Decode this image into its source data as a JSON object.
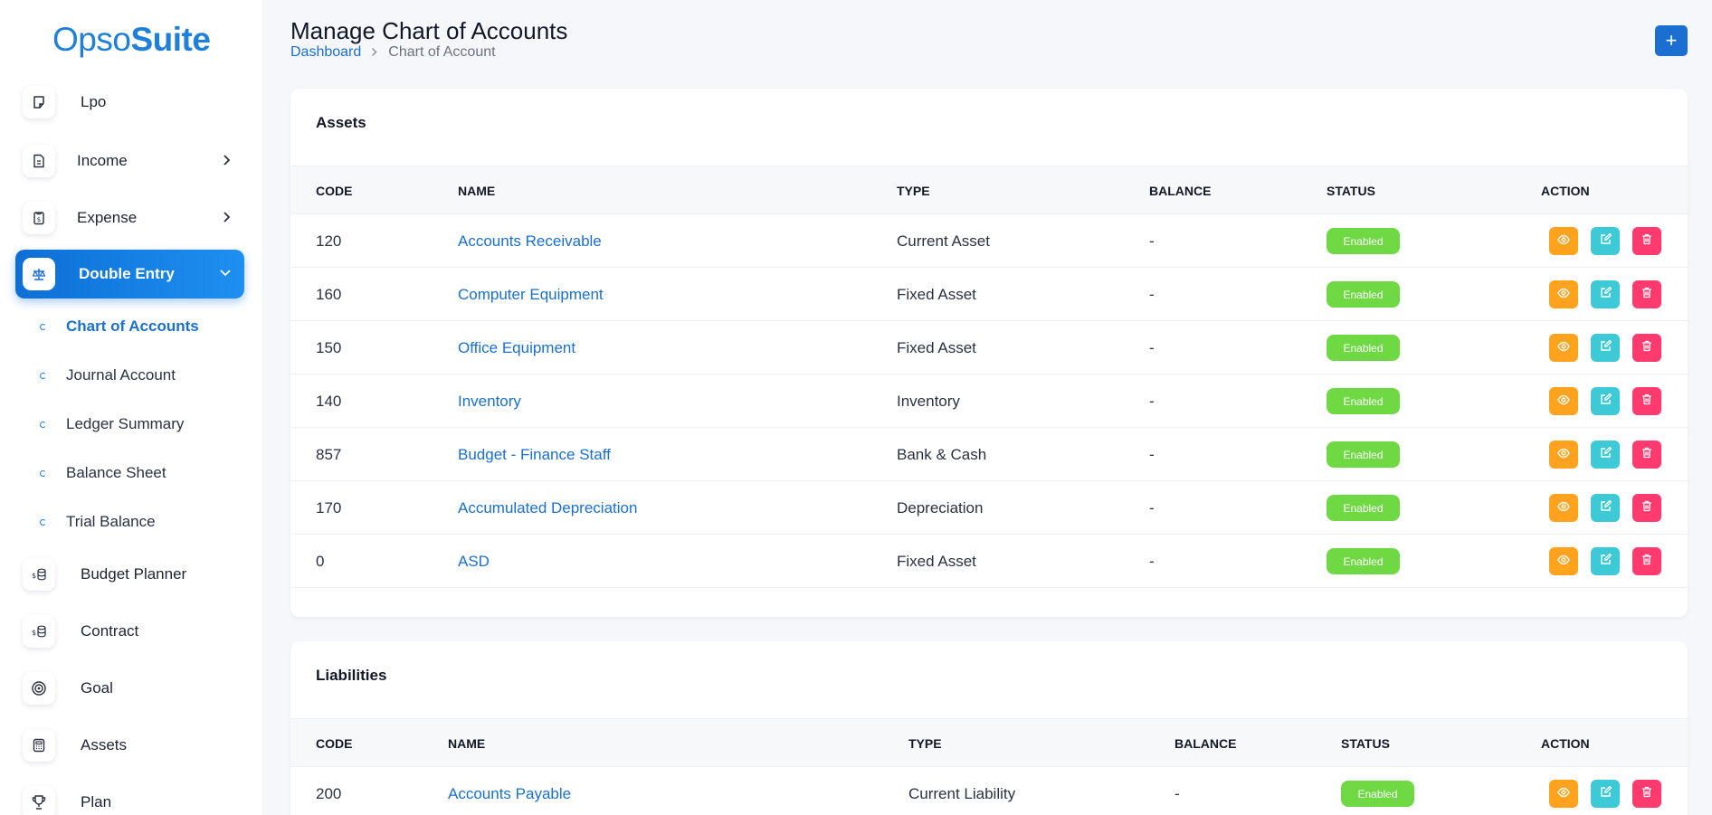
{
  "logo": {
    "part1": "Opso",
    "part2": "Suite"
  },
  "sidebar": {
    "items": [
      {
        "label": "Lpo",
        "icon": "sticky-note-icon"
      },
      {
        "label": "Income",
        "icon": "file-invoice-icon"
      },
      {
        "label": "Expense",
        "icon": "receipt-icon"
      },
      {
        "label": "Double Entry",
        "icon": "scale-icon"
      },
      {
        "label": "Budget Planner",
        "icon": "coins-icon"
      },
      {
        "label": "Contract",
        "icon": "coins-icon"
      },
      {
        "label": "Goal",
        "icon": "target-icon"
      },
      {
        "label": "Assets",
        "icon": "calculator-icon"
      },
      {
        "label": "Plan",
        "icon": "trophy-icon"
      }
    ],
    "subitems": [
      {
        "label": "Chart of Accounts"
      },
      {
        "label": "Journal Account"
      },
      {
        "label": "Ledger Summary"
      },
      {
        "label": "Balance Sheet"
      },
      {
        "label": "Trial Balance"
      }
    ]
  },
  "header": {
    "title": "Manage Chart of Accounts",
    "breadcrumb": [
      "Dashboard",
      "Chart of Account"
    ],
    "add_label": "+"
  },
  "columns": [
    "CODE",
    "NAME",
    "TYPE",
    "BALANCE",
    "STATUS",
    "ACTION"
  ],
  "sections": [
    {
      "title": "Assets",
      "rows": [
        {
          "code": "120",
          "name": "Accounts Receivable",
          "type": "Current Asset",
          "balance": "-",
          "status": "Enabled"
        },
        {
          "code": "160",
          "name": "Computer Equipment",
          "type": "Fixed Asset",
          "balance": "-",
          "status": "Enabled"
        },
        {
          "code": "150",
          "name": "Office Equipment",
          "type": "Fixed Asset",
          "balance": "-",
          "status": "Enabled"
        },
        {
          "code": "140",
          "name": "Inventory",
          "type": "Inventory",
          "balance": "-",
          "status": "Enabled"
        },
        {
          "code": "857",
          "name": "Budget - Finance Staff",
          "type": "Bank & Cash",
          "balance": "-",
          "status": "Enabled"
        },
        {
          "code": "170",
          "name": "Accumulated Depreciation",
          "type": "Depreciation",
          "balance": "-",
          "status": "Enabled"
        },
        {
          "code": "0",
          "name": "ASD",
          "type": "Fixed Asset",
          "balance": "-",
          "status": "Enabled"
        }
      ]
    },
    {
      "title": "Liabilities",
      "rows": [
        {
          "code": "200",
          "name": "Accounts Payable",
          "type": "Current Liability",
          "balance": "-",
          "status": "Enabled"
        }
      ]
    }
  ],
  "colors": {
    "primary": "#1a6fd1",
    "enabled": "#6fd943",
    "view": "#ffa21d",
    "edit": "#3ec9d6",
    "delete": "#ff3a6e"
  }
}
